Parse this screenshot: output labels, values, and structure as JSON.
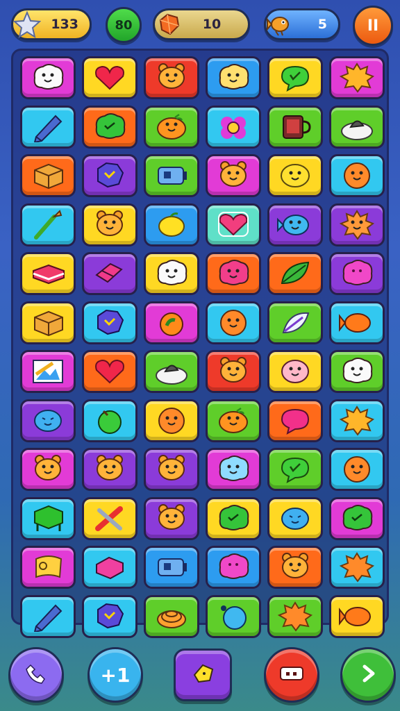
{
  "hud": {
    "stars": {
      "value": "133",
      "icon": "star-icon"
    },
    "moves": {
      "value": "80"
    },
    "gems": {
      "value": "10",
      "icon": "gem-icon"
    },
    "fish": {
      "value": "5",
      "icon": "fish-icon"
    },
    "pause": {
      "label": "II"
    }
  },
  "colors": {
    "magenta": "#e23bd6",
    "yellow": "#ffd823",
    "orange": "#ff6a1a",
    "blue": "#2d9cf0",
    "lime": "#5fce2a",
    "cyan": "#32c8f0",
    "purple": "#8b3bd9",
    "red": "#ee3a2a",
    "teal": "#5fe0c8"
  },
  "board": {
    "rows": [
      [
        {
          "bg": "magenta",
          "icon": "cloud-face"
        },
        {
          "bg": "yellow",
          "icon": "heart"
        },
        {
          "bg": "red",
          "icon": "bear-face"
        },
        {
          "bg": "blue",
          "icon": "cloud-face-yellow"
        },
        {
          "bg": "yellow",
          "icon": "speech-bubble"
        },
        {
          "bg": "magenta",
          "icon": "splat"
        }
      ],
      [
        {
          "bg": "cyan",
          "icon": "pencil"
        },
        {
          "bg": "orange",
          "icon": "green-blob"
        },
        {
          "bg": "lime",
          "icon": "orange-fruit"
        },
        {
          "bg": "cyan",
          "icon": "flower"
        },
        {
          "bg": "lime",
          "icon": "mug"
        },
        {
          "bg": "lime",
          "icon": "dish"
        }
      ],
      [
        {
          "bg": "orange",
          "icon": "box"
        },
        {
          "bg": "purple",
          "icon": "blue-blob"
        },
        {
          "bg": "lime",
          "icon": "battery"
        },
        {
          "bg": "magenta",
          "icon": "bear-face"
        },
        {
          "bg": "yellow",
          "icon": "lemon-face"
        },
        {
          "bg": "cyan",
          "icon": "orange-face"
        }
      ],
      [
        {
          "bg": "cyan",
          "icon": "brush"
        },
        {
          "bg": "yellow",
          "icon": "bear-face"
        },
        {
          "bg": "blue",
          "icon": "lemon"
        },
        {
          "bg": "teal",
          "icon": "heart-pink"
        },
        {
          "bg": "purple",
          "icon": "fish-blob"
        },
        {
          "bg": "purple",
          "icon": "splat-face"
        }
      ],
      [
        {
          "bg": "yellow",
          "icon": "book"
        },
        {
          "bg": "purple",
          "icon": "eraser"
        },
        {
          "bg": "yellow",
          "icon": "cloud-face"
        },
        {
          "bg": "orange",
          "icon": "splat-face-pink"
        },
        {
          "bg": "orange",
          "icon": "leaf"
        },
        {
          "bg": "purple",
          "icon": "pink-blob"
        }
      ],
      [
        {
          "bg": "yellow",
          "icon": "box"
        },
        {
          "bg": "cyan",
          "icon": "blue-blob"
        },
        {
          "bg": "magenta",
          "icon": "apple"
        },
        {
          "bg": "cyan",
          "icon": "orange-face"
        },
        {
          "bg": "lime",
          "icon": "feather"
        },
        {
          "bg": "cyan",
          "icon": "fish-orange"
        }
      ],
      [
        {
          "bg": "magenta",
          "icon": "picture"
        },
        {
          "bg": "orange",
          "icon": "heart"
        },
        {
          "bg": "lime",
          "icon": "dish"
        },
        {
          "bg": "red",
          "icon": "bear-face"
        },
        {
          "bg": "yellow",
          "icon": "pig-face"
        },
        {
          "bg": "lime",
          "icon": "cloud-face"
        }
      ],
      [
        {
          "bg": "purple",
          "icon": "blue-face"
        },
        {
          "bg": "cyan",
          "icon": "green-ball"
        },
        {
          "bg": "yellow",
          "icon": "orange-face"
        },
        {
          "bg": "lime",
          "icon": "orange-fruit"
        },
        {
          "bg": "orange",
          "icon": "speech-pink"
        },
        {
          "bg": "cyan",
          "icon": "splat"
        }
      ],
      [
        {
          "bg": "magenta",
          "icon": "bear-face"
        },
        {
          "bg": "purple",
          "icon": "bear-face"
        },
        {
          "bg": "purple",
          "icon": "bear-face"
        },
        {
          "bg": "magenta",
          "icon": "cloud-face-blue"
        },
        {
          "bg": "lime",
          "icon": "speech-bubble"
        },
        {
          "bg": "cyan",
          "icon": "orange-face"
        }
      ],
      [
        {
          "bg": "cyan",
          "icon": "green-box"
        },
        {
          "bg": "yellow",
          "icon": "tools"
        },
        {
          "bg": "purple",
          "icon": "bear-face"
        },
        {
          "bg": "yellow",
          "icon": "green-blob"
        },
        {
          "bg": "yellow",
          "icon": "blue-face"
        },
        {
          "bg": "magenta",
          "icon": "green-blob"
        }
      ],
      [
        {
          "bg": "magenta",
          "icon": "scroll"
        },
        {
          "bg": "cyan",
          "icon": "eraser-pink"
        },
        {
          "bg": "blue",
          "icon": "battery"
        },
        {
          "bg": "blue",
          "icon": "pink-blob"
        },
        {
          "bg": "orange",
          "icon": "bear-face"
        },
        {
          "bg": "cyan",
          "icon": "splat-orange"
        }
      ],
      [
        {
          "bg": "cyan",
          "icon": "pencil"
        },
        {
          "bg": "cyan",
          "icon": "blue-blob"
        },
        {
          "bg": "lime",
          "icon": "coil"
        },
        {
          "bg": "lime",
          "icon": "blue-ball"
        },
        {
          "bg": "lime",
          "icon": "splat-orange"
        },
        {
          "bg": "yellow",
          "icon": "fish-orange"
        }
      ]
    ]
  },
  "bottom": [
    {
      "name": "phone-button",
      "icon": "phone-icon",
      "color": "#8c6bf0"
    },
    {
      "name": "plus-one-button",
      "icon": "plus-one-icon",
      "color": "#39b4ee",
      "label": "+1"
    },
    {
      "name": "hint-button",
      "icon": "lemon-icon",
      "color": "#8a3fe0"
    },
    {
      "name": "ticket-button",
      "icon": "ticket-icon",
      "color": "#ee3a2a"
    },
    {
      "name": "next-button",
      "icon": "chevron-right-icon",
      "color": "#3fbf3a"
    }
  ]
}
